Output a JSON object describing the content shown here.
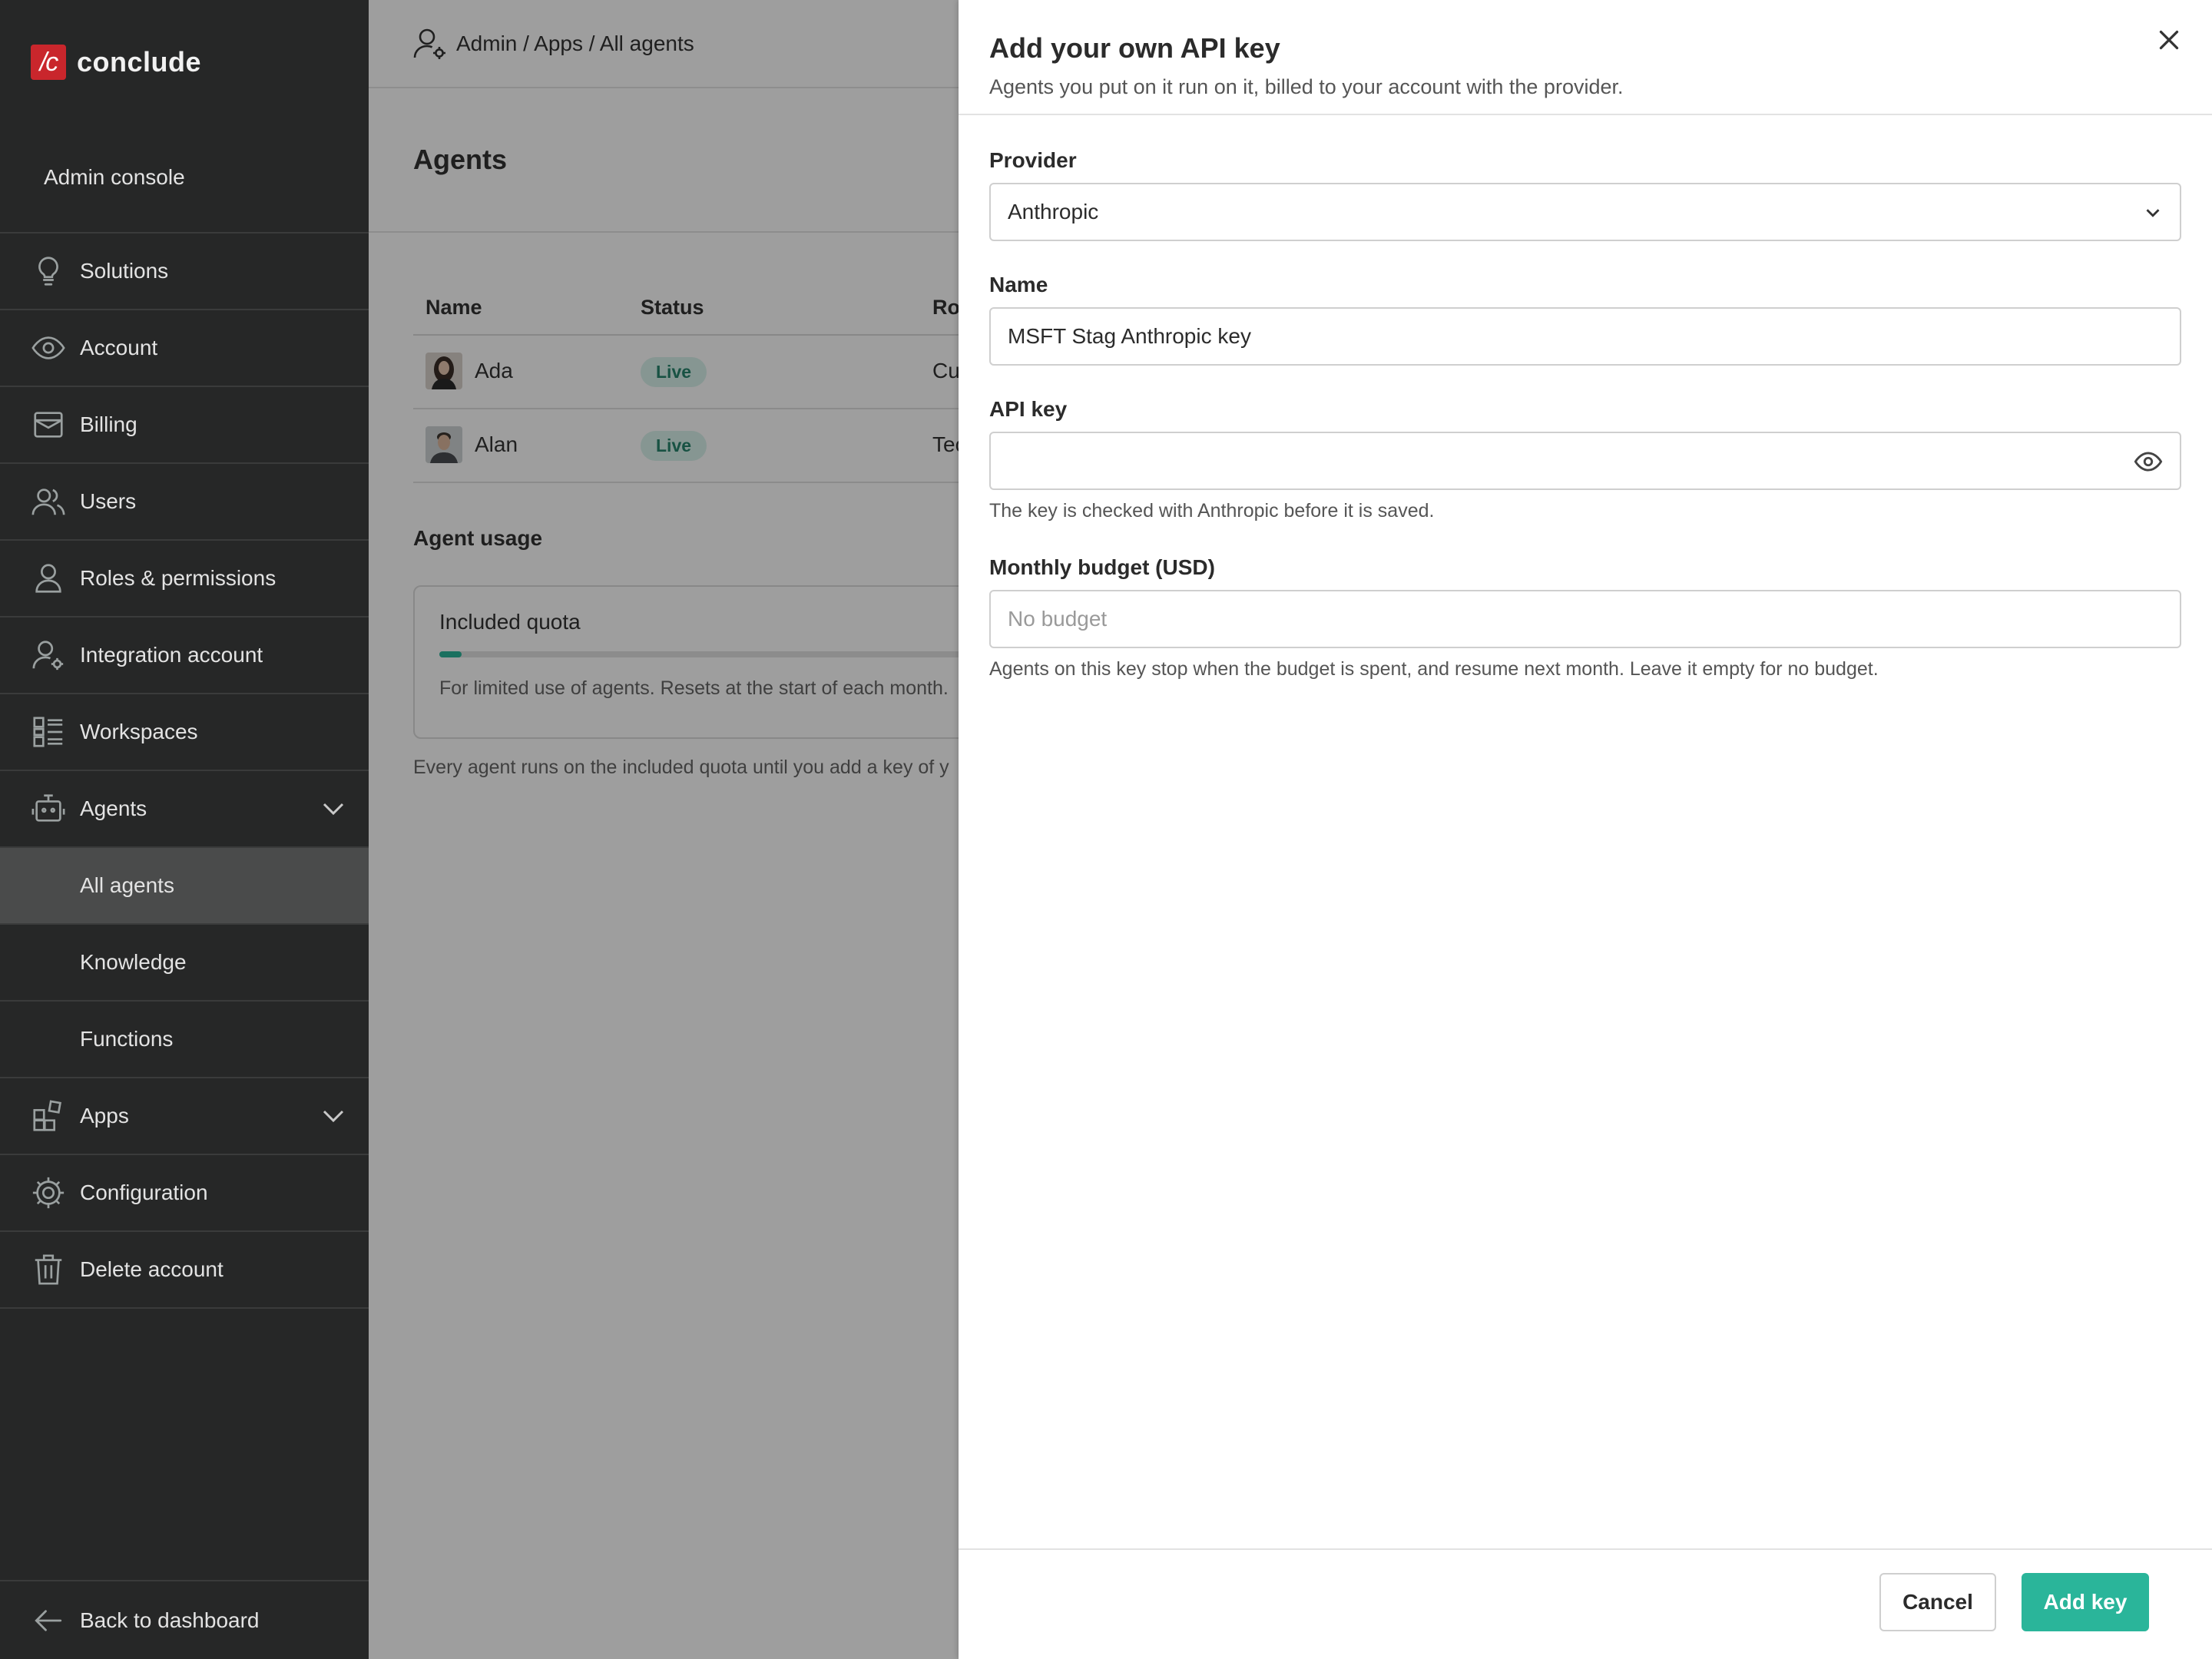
{
  "brand": {
    "logo_mark": "/c",
    "name": "conclude",
    "color": "#c9262c"
  },
  "sidebar": {
    "console_label": "Admin console",
    "items": [
      {
        "label": "Solutions",
        "icon": "lightbulb-icon"
      },
      {
        "label": "Account",
        "icon": "eye-icon"
      },
      {
        "label": "Billing",
        "icon": "billing-icon"
      },
      {
        "label": "Users",
        "icon": "users-icon"
      },
      {
        "label": "Roles & permissions",
        "icon": "user-icon"
      },
      {
        "label": "Integration account",
        "icon": "user-gear-icon"
      },
      {
        "label": "Workspaces",
        "icon": "workspaces-icon"
      },
      {
        "label": "Agents",
        "icon": "robot-icon",
        "expanded": true
      },
      {
        "label": "All agents",
        "active": true
      },
      {
        "label": "Knowledge"
      },
      {
        "label": "Functions"
      },
      {
        "label": "Apps",
        "icon": "apps-icon",
        "expanded": false
      },
      {
        "label": "Configuration",
        "icon": "gear-icon"
      },
      {
        "label": "Delete account",
        "icon": "trash-icon"
      }
    ],
    "back_label": "Back to dashboard"
  },
  "main": {
    "breadcrumb": "Admin / Apps / All agents",
    "page_title": "Agents",
    "table": {
      "headers": [
        "Name",
        "Status",
        "Ro"
      ],
      "rows": [
        {
          "name": "Ada",
          "status": "Live",
          "role": "Cu"
        },
        {
          "name": "Alan",
          "status": "Live",
          "role": "Tec"
        }
      ]
    },
    "usage_title": "Agent usage",
    "quota": {
      "title": "Included quota",
      "progress": 0.04,
      "description": "For limited use of agents. Resets at the start of each month."
    },
    "note": "Every agent runs on the included quota until you add a key of y"
  },
  "drawer": {
    "title": "Add your own API key",
    "subtitle": "Agents you put on it run on it, billed to your account with the provider.",
    "provider": {
      "label": "Provider",
      "value": "Anthropic"
    },
    "name": {
      "label": "Name",
      "value": "MSFT Stag Anthropic key"
    },
    "api_key": {
      "label": "API key",
      "value": "",
      "hint": "The key is checked with Anthropic before it is saved."
    },
    "budget": {
      "label": "Monthly budget (USD)",
      "placeholder": "No budget",
      "hint": "Agents on this key stop when the budget is spent, and resume next month. Leave it empty for no budget."
    },
    "cancel_label": "Cancel",
    "submit_label": "Add key",
    "accent_color": "#2ab59a"
  }
}
